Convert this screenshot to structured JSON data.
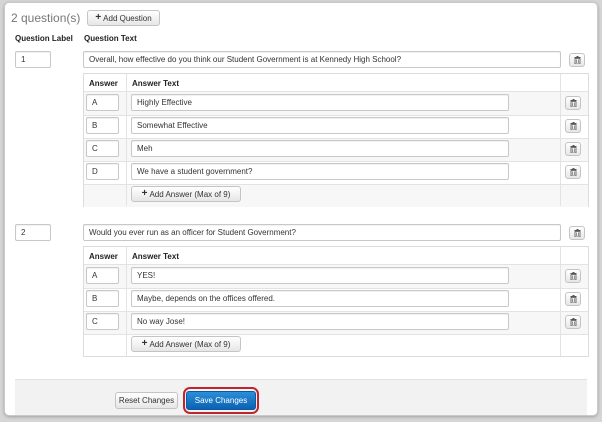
{
  "header": {
    "question_count": "2 question(s)",
    "add_question_label": "Add Question"
  },
  "columns": {
    "question_label": "Question Label",
    "question_text": "Question Text",
    "answer": "Answer",
    "answer_text": "Answer Text"
  },
  "questions": [
    {
      "label": "1",
      "text": "Overall, how effective do you think our Student Government is at Kennedy High School?",
      "answers": [
        {
          "label": "A",
          "text": "Highly Effective"
        },
        {
          "label": "B",
          "text": "Somewhat Effective"
        },
        {
          "label": "C",
          "text": "Meh"
        },
        {
          "label": "D",
          "text": "We have a student government?"
        }
      ],
      "add_answer_label": "Add Answer (Max of 9)"
    },
    {
      "label": "2",
      "text": "Would you ever run as an officer for Student Government?",
      "answers": [
        {
          "label": "A",
          "text": "YES!"
        },
        {
          "label": "B",
          "text": "Maybe, depends on the offices offered."
        },
        {
          "label": "C",
          "text": "No way Jose!"
        }
      ],
      "add_answer_label": "Add Answer (Max of 9)"
    }
  ],
  "footer": {
    "reset_label": "Reset Changes",
    "save_label": "Save Changes"
  },
  "icons": {
    "add": "plus-icon",
    "delete": "trash-icon"
  },
  "colors": {
    "primary": "#0b61b2",
    "highlight": "#c0252e"
  }
}
